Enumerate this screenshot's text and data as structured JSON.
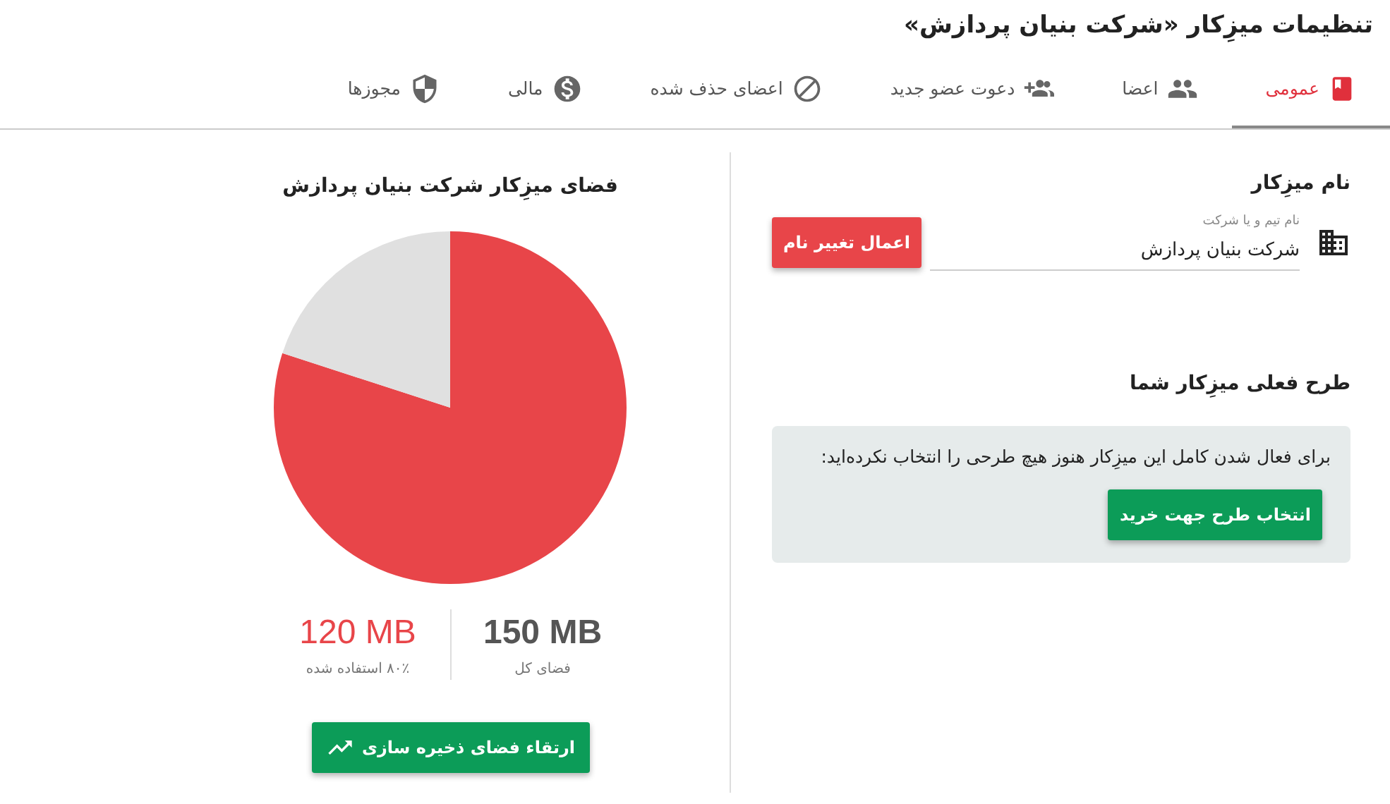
{
  "title": "تنظیمات میزِکار «شرکت بنیان پردازش»",
  "tabs": [
    {
      "label": "عمومی",
      "kind": "book",
      "selected": true
    },
    {
      "label": "اعضا",
      "kind": "people",
      "selected": false
    },
    {
      "label": "دعوت عضو جدید",
      "kind": "invite",
      "selected": false
    },
    {
      "label": "اعضای حذف شده",
      "kind": "removed",
      "selected": false
    },
    {
      "label": "مالی",
      "kind": "finance",
      "selected": false
    },
    {
      "label": "مجوزها",
      "kind": "permissions",
      "selected": false
    }
  ],
  "name_section": {
    "heading": "نام میزِکار",
    "field_label": "نام تیم و یا شرکت",
    "field_value": "شرکت بنیان پردازش",
    "button": "اعمال تغییر نام"
  },
  "plan_section": {
    "heading": "طرح فعلی میزِکار شما",
    "message": "برای فعال شدن کامل این میزِکار هنوز هیچ طرحی را انتخاب نکرده‌اید:",
    "button": "انتخاب طرح جهت خرید"
  },
  "storage": {
    "title": "فضای میزِکار شرکت بنیان پردازش",
    "total": {
      "value": "150 MB",
      "label": "فضای کل"
    },
    "used": {
      "value": "120 MB",
      "label": "۸۰٪ استفاده شده"
    },
    "button": "ارتقاء فضای ذخیره سازی"
  }
}
